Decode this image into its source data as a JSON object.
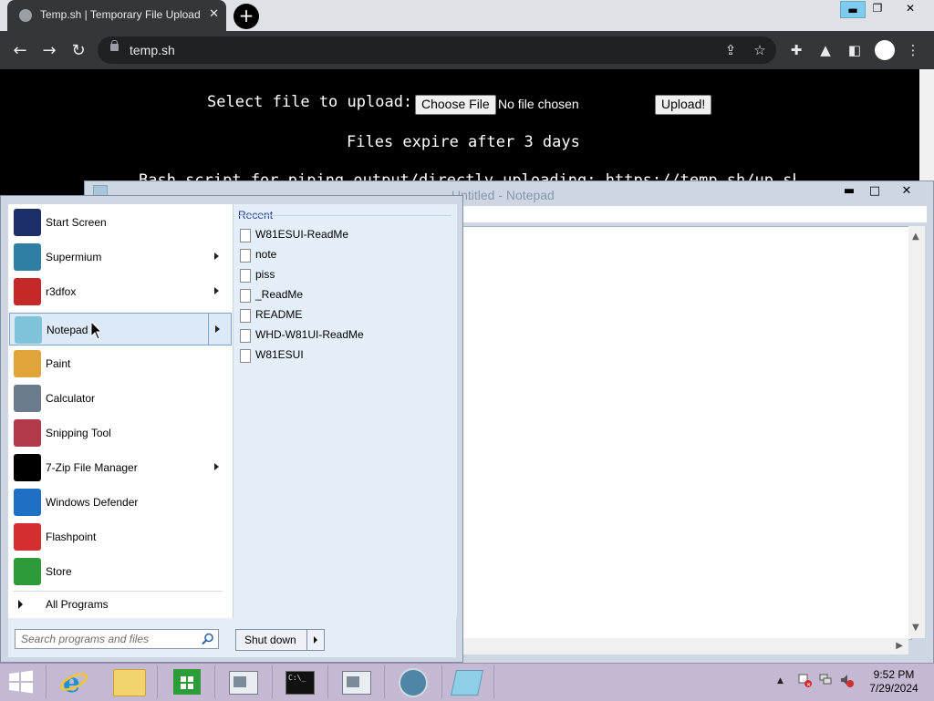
{
  "browser": {
    "tab_title": "Temp.sh | Temporary File Upload",
    "tab_close": "✕",
    "new_tab": "+",
    "url": "temp.sh",
    "window_min": "▬",
    "window_restore": "❐",
    "window_close": "✕"
  },
  "page": {
    "select_label": "Select file to upload:",
    "choose_file": "Choose File",
    "no_file": "No file chosen",
    "upload": "Upload!",
    "expire": "Files expire after 3 days",
    "bash_line": "Bash script for piping output/directly uploading: https://temp.sh/up.sh"
  },
  "notepad": {
    "title": "Untitled - Notepad",
    "min": "▬",
    "max": "□",
    "close": "✕"
  },
  "start_menu": {
    "programs": [
      {
        "label": "Start Screen",
        "icon": "start-screen-icon",
        "color": "#1c2f6b",
        "submenu": false
      },
      {
        "label": "Supermium",
        "icon": "supermium-icon",
        "color": "#2f7ea3",
        "submenu": true
      },
      {
        "label": "r3dfox",
        "icon": "r3dfox-icon",
        "color": "#c62828",
        "submenu": true
      },
      {
        "label": "Notepad",
        "icon": "notepad-icon",
        "color": "#7fc3db",
        "submenu": true
      },
      {
        "label": "Paint",
        "icon": "paint-icon",
        "color": "#e0a43a",
        "submenu": false
      },
      {
        "label": "Calculator",
        "icon": "calculator-icon",
        "color": "#6b7b8c",
        "submenu": false
      },
      {
        "label": "Snipping Tool",
        "icon": "snipping-tool-icon",
        "color": "#b23a48",
        "submenu": false
      },
      {
        "label": "7-Zip File Manager",
        "icon": "7zip-icon",
        "color": "#000000",
        "submenu": true
      },
      {
        "label": "Windows Defender",
        "icon": "windows-defender-icon",
        "color": "#1f6fc5",
        "submenu": false
      },
      {
        "label": "Flashpoint",
        "icon": "flashpoint-icon",
        "color": "#d32f2f",
        "submenu": false
      },
      {
        "label": "Store",
        "icon": "store-icon",
        "color": "#2e9b3b",
        "submenu": false
      }
    ],
    "all_programs": "All Programs",
    "search_placeholder": "Search programs and files",
    "shutdown": "Shut down",
    "recent_header": "Recent",
    "recent": [
      "W81ESUI-ReadMe",
      "note",
      "piss",
      "_ReadMe",
      "README",
      "WHD-W81UI-ReadMe",
      "W81ESUI"
    ]
  },
  "taskbar": {
    "items": [
      "start-button",
      "internet-explorer-icon",
      "file-explorer-icon",
      "store-taskbar-icon",
      "notepad-taskbar-icon",
      "command-prompt-icon",
      "notepad-taskbar-icon-2",
      "supermium-taskbar-icon",
      "notepad-pinned-icon"
    ],
    "time": "9:52 PM",
    "date": "7/29/2024",
    "tray_arrow": "▲"
  }
}
